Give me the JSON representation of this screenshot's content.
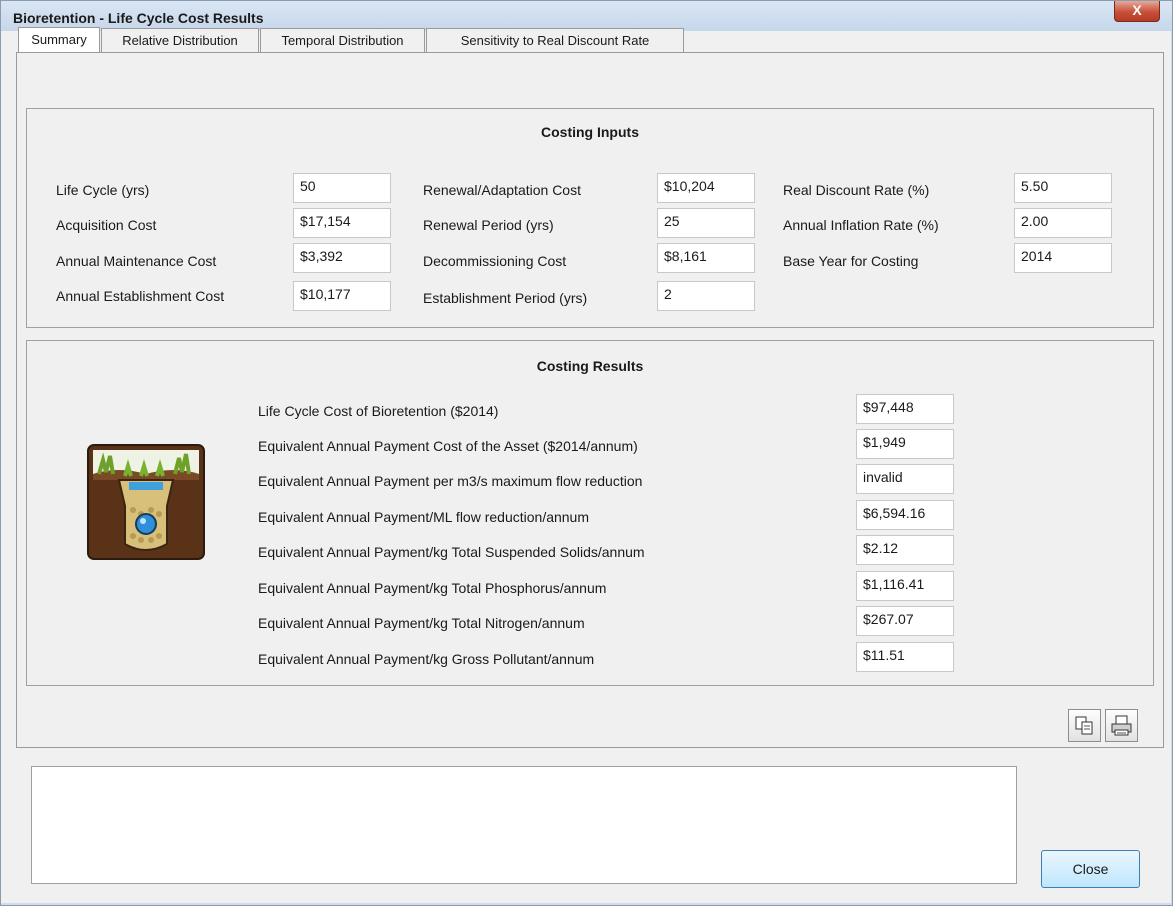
{
  "window": {
    "title": "Bioretention - Life Cycle Cost Results",
    "close_glyph": "X"
  },
  "tabs": [
    {
      "label": "Summary",
      "active": true
    },
    {
      "label": "Relative Distribution",
      "active": false
    },
    {
      "label": "Temporal Distribution",
      "active": false
    },
    {
      "label": "Sensitivity to Real Discount Rate",
      "active": false
    }
  ],
  "inputs": {
    "heading": "Costing Inputs",
    "life_cycle": {
      "label": "Life Cycle (yrs)",
      "value": "50"
    },
    "acquisition": {
      "label": "Acquisition Cost",
      "value": "$17,154"
    },
    "annual_maintenance": {
      "label": "Annual Maintenance Cost",
      "value": "$3,392"
    },
    "annual_establishment": {
      "label": "Annual Establishment Cost",
      "value": "$10,177"
    },
    "renewal_cost": {
      "label": "Renewal/Adaptation Cost",
      "value": "$10,204"
    },
    "renewal_period": {
      "label": "Renewal Period (yrs)",
      "value": "25"
    },
    "decommissioning": {
      "label": "Decommissioning Cost",
      "value": "$8,161"
    },
    "establishment_period": {
      "label": "Establishment Period (yrs)",
      "value": "2"
    },
    "real_discount": {
      "label": "Real Discount Rate (%)",
      "value": "5.50"
    },
    "annual_inflation": {
      "label": "Annual Inflation Rate (%)",
      "value": "2.00"
    },
    "base_year": {
      "label": "Base Year for Costing",
      "value": "2014"
    }
  },
  "results": {
    "heading": "Costing Results",
    "rows": [
      {
        "label": "Life Cycle Cost of Bioretention ($2014)",
        "value": "$97,448"
      },
      {
        "label": "Equivalent Annual Payment Cost of the Asset ($2014/annum)",
        "value": "$1,949"
      },
      {
        "label": "Equivalent Annual Payment per m3/s maximum flow reduction",
        "value": "invalid"
      },
      {
        "label": "Equivalent Annual Payment/ML flow reduction/annum",
        "value": "$6,594.16"
      },
      {
        "label": "Equivalent Annual Payment/kg Total Suspended Solids/annum",
        "value": "$2.12"
      },
      {
        "label": "Equivalent Annual Payment/kg Total Phosphorus/annum",
        "value": "$1,116.41"
      },
      {
        "label": "Equivalent Annual Payment/kg Total Nitrogen/annum",
        "value": "$267.07"
      },
      {
        "label": "Equivalent Annual Payment/kg Gross Pollutant/annum",
        "value": "$11.51"
      }
    ]
  },
  "toolbar": {
    "copy_icon": "copy-icon",
    "print_icon": "print-icon"
  },
  "footer": {
    "close_label": "Close",
    "notes_value": ""
  },
  "colors": {
    "title_bg": "#c6d7ea",
    "close_red": "#c7503a",
    "panel_bg": "#f0f0f0"
  }
}
